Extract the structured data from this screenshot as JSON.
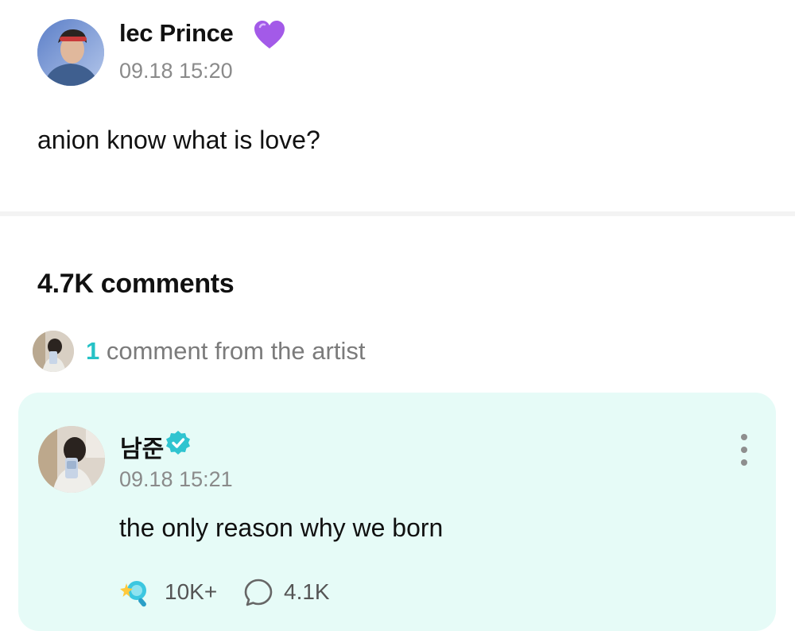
{
  "post": {
    "author_name": "lec Prince",
    "author_badge": "purple-heart-icon",
    "timestamp": "09.18 15:20",
    "text": "anion know what is love?"
  },
  "comments_section": {
    "count_label": "4.7K comments",
    "artist_summary": {
      "count": "1",
      "label": " comment from the artist"
    }
  },
  "artist_comment": {
    "author_name": "남준",
    "verified": true,
    "timestamp": "09.18 15:21",
    "text": "the only reason why we born",
    "cheers_count": "10K+",
    "replies_count": "4.1K",
    "more_icon": "more-vertical-icon"
  },
  "colors": {
    "accent": "#25c2c6",
    "card_background": "#e6fbf7",
    "heart": "#9b4fe0"
  }
}
